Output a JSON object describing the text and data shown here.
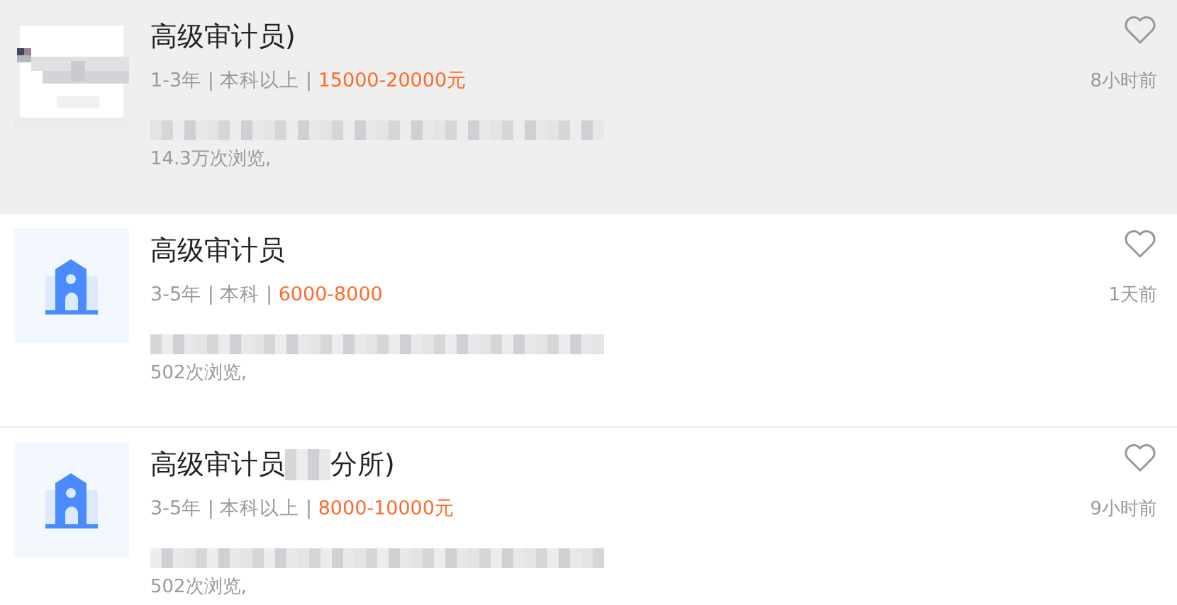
{
  "jobs": [
    {
      "kind": "picture",
      "highlighted": true,
      "title": "高级审计员)",
      "title_redacted": false,
      "requirements": "1-3年 | 本科以上 |",
      "salary": "15000-20000元",
      "time": "8小时前",
      "views": "14.3万次浏览,"
    },
    {
      "kind": "building",
      "highlighted": false,
      "title": "高级审计员",
      "title_redacted": false,
      "requirements": "3-5年 | 本科 |",
      "salary": "6000-8000",
      "time": "1天前",
      "views": "502次浏览,"
    },
    {
      "kind": "building",
      "highlighted": false,
      "title": "高级审计员",
      "title_redacted": true,
      "title_suffix": "分所)",
      "requirements": "3-5年 | 本科以上 |",
      "salary": "8000-10000元",
      "time": "9小时前",
      "views": "502次浏览,"
    }
  ]
}
